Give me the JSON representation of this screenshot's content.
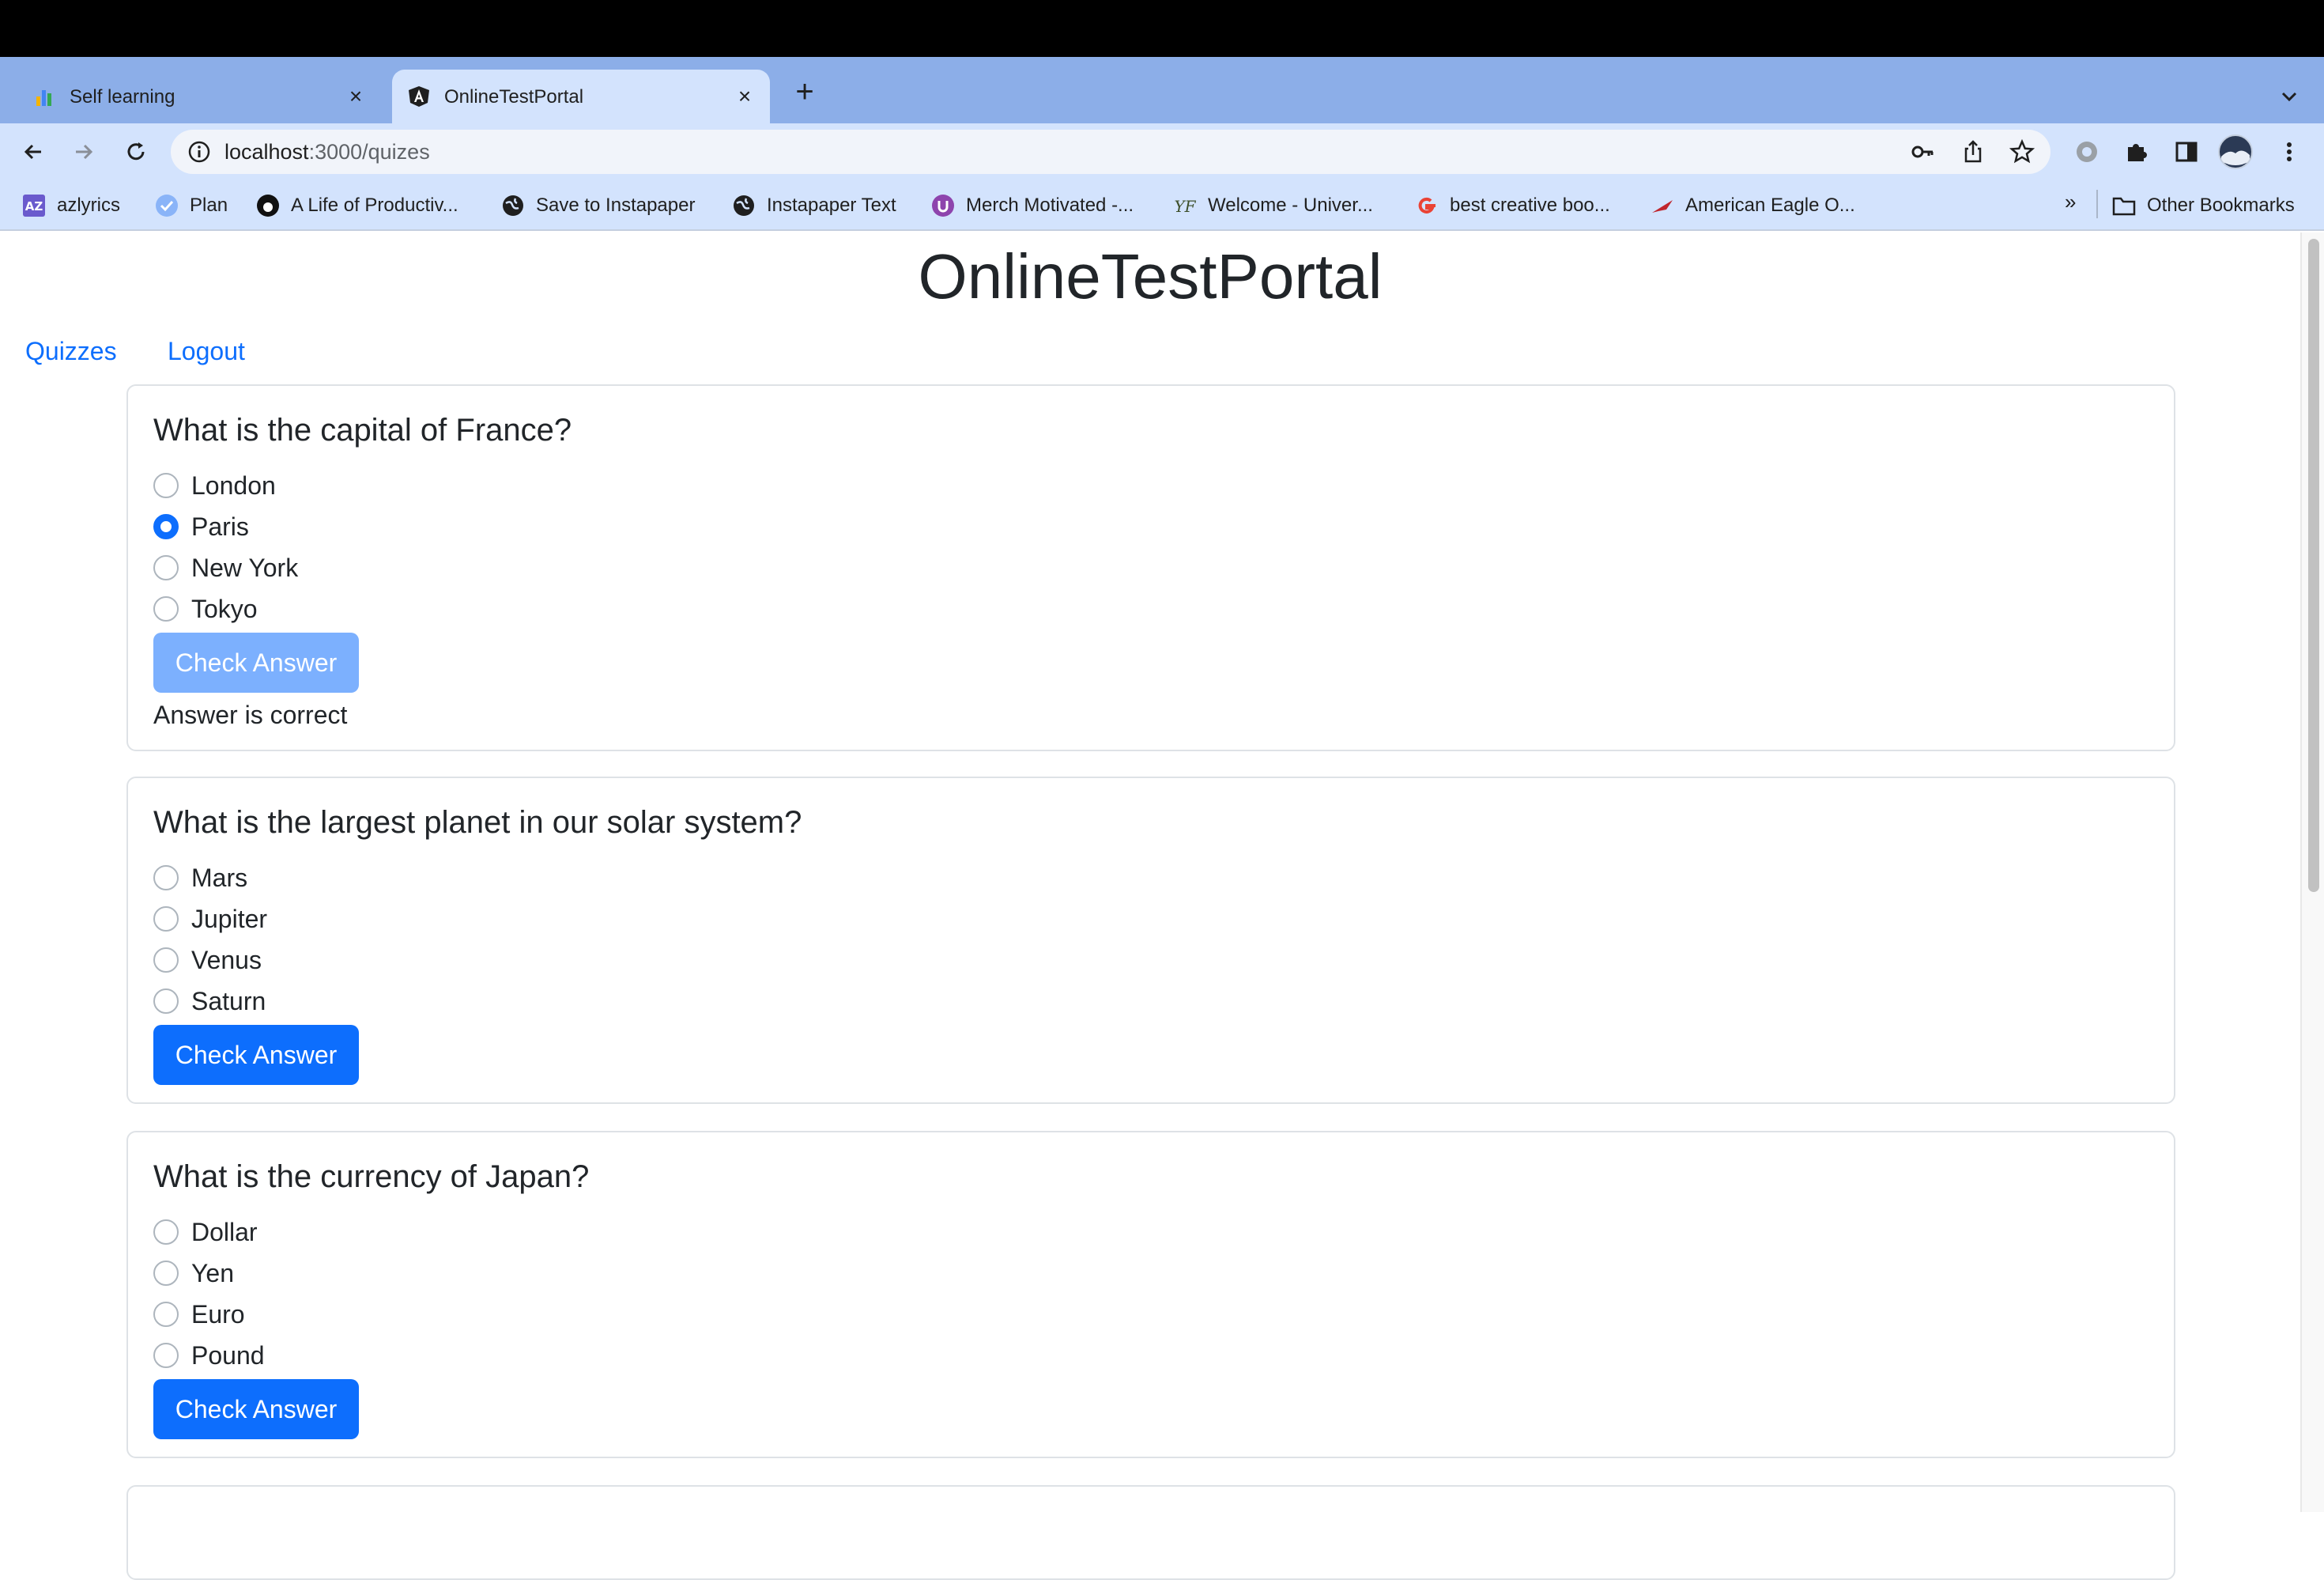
{
  "browser": {
    "tabs": [
      {
        "title": "Self learning",
        "favicon": "bar-chart-icon",
        "active": false
      },
      {
        "title": "OnlineTestPortal",
        "favicon": "angular-icon",
        "active": true
      }
    ],
    "new_tab_label": "+",
    "close_label": "×",
    "url_host": "localhost",
    "url_path": ":3000/quizes",
    "bookmarks": [
      {
        "label": "azlyrics",
        "icon": "az-icon"
      },
      {
        "label": "Plan",
        "icon": "check-icon"
      },
      {
        "label": "A Life of Productiv...",
        "icon": "circle-icon"
      },
      {
        "label": "Save to Instapaper",
        "icon": "globe-icon"
      },
      {
        "label": "Instapaper Text",
        "icon": "globe-icon"
      },
      {
        "label": "Merch Motivated -...",
        "icon": "merch-icon"
      },
      {
        "label": "Welcome - Univer...",
        "icon": "uf-icon"
      },
      {
        "label": "best creative boo...",
        "icon": "google-icon"
      },
      {
        "label": "American Eagle O...",
        "icon": "eagle-icon"
      }
    ],
    "bookmarks_overflow": "»",
    "other_bookmarks": "Other Bookmarks",
    "colors": {
      "tabstrip": "#8caee8",
      "toolbar": "#d3e3fd"
    }
  },
  "app": {
    "brand": "OnlineTestPortal",
    "nav": {
      "quizzes": "Quizzes",
      "logout": "Logout"
    },
    "accent": "#0d6efd"
  },
  "questions": [
    {
      "question": "What is the capital of France?",
      "options": [
        "London",
        "Paris",
        "New York",
        "Tokyo"
      ],
      "selected": "Paris",
      "button_label": "Check Answer",
      "button_disabled": true,
      "result": "Answer is correct"
    },
    {
      "question": "What is the largest planet in our solar system?",
      "options": [
        "Mars",
        "Jupiter",
        "Venus",
        "Saturn"
      ],
      "selected": null,
      "button_label": "Check Answer",
      "button_disabled": false,
      "result": ""
    },
    {
      "question": "What is the currency of Japan?",
      "options": [
        "Dollar",
        "Yen",
        "Euro",
        "Pound"
      ],
      "selected": null,
      "button_label": "Check Answer",
      "button_disabled": false,
      "result": ""
    }
  ]
}
